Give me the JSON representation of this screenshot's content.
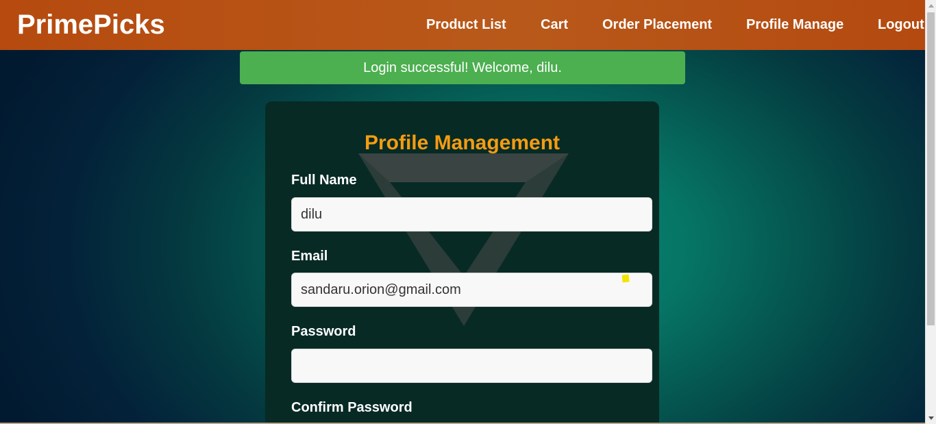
{
  "navbar": {
    "brand": "PrimePicks",
    "links": [
      "Product List",
      "Cart",
      "Order Placement",
      "Profile Manage",
      "Logout"
    ]
  },
  "alert": {
    "message": "Login successful! Welcome, dilu."
  },
  "profile": {
    "title": "Profile Management",
    "fields": {
      "full_name": {
        "label": "Full Name",
        "value": "dilu"
      },
      "email": {
        "label": "Email",
        "value": "sandaru.orion@gmail.com"
      },
      "password": {
        "label": "Password",
        "value": ""
      },
      "confirm_password": {
        "label": "Confirm Password"
      }
    }
  },
  "colors": {
    "navbar": "#b8591a",
    "alert": "#4caf50",
    "title": "#f39c12",
    "card": "#072a25"
  }
}
